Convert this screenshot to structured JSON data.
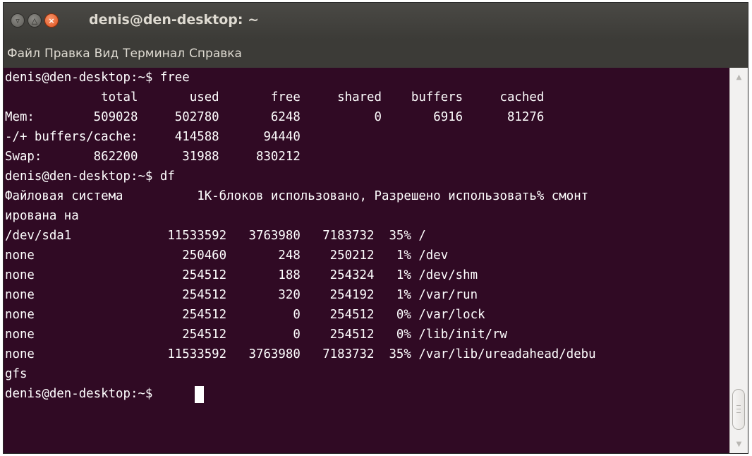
{
  "window": {
    "title": "denis@den-desktop: ~"
  },
  "menubar": {
    "items": [
      "Файл",
      "Правка",
      "Вид",
      "Терминал",
      "Справка"
    ]
  },
  "terminal": {
    "lines": [
      "denis@den-desktop:~$ free",
      "             total       used       free     shared    buffers     cached",
      "Mem:        509028     502780       6248          0       6916      81276",
      "-/+ buffers/cache:     414588      94440",
      "Swap:       862200      31988     830212",
      "denis@den-desktop:~$ df",
      "Файловая система          1K-блоков использовано, Разрешено использовать% смонт",
      "ирована на",
      "/dev/sda1             11533592   3763980   7183732  35% /",
      "none                    250460       248    250212   1% /dev",
      "none                    254512       188    254324   1% /dev/shm",
      "none                    254512       320    254192   1% /var/run",
      "none                    254512         0    254512   0% /var/lock",
      "none                    254512         0    254512   0% /lib/init/rw",
      "none                  11533592   3763980   7183732  35% /var/lib/ureadahead/debu",
      "gfs",
      "denis@den-desktop:~$ "
    ]
  },
  "icons": {
    "minimize": "minimize-icon",
    "maximize": "maximize-icon",
    "close": "close-icon",
    "scroll_up": "arrow-up-icon",
    "scroll_down": "arrow-down-icon"
  },
  "colors": {
    "terminal_bg": "#300a24",
    "terminal_fg": "#ffffff",
    "titlebar_bg": "#3c3b37",
    "close_button": "#e0531f"
  }
}
